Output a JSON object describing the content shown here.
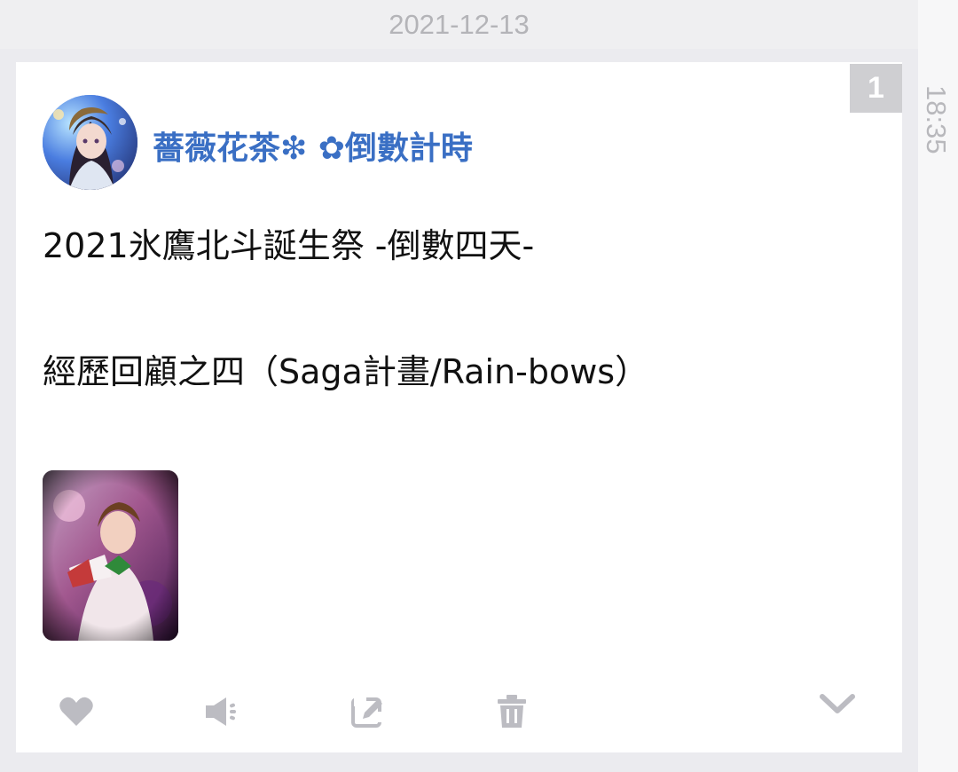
{
  "header": {
    "date": "2021-12-13"
  },
  "side": {
    "time": "18:35"
  },
  "post": {
    "badge": "1",
    "author": "薔薇花茶❇ ✿倒數計時",
    "lines": [
      "2021氷鷹北斗誕生祭 -倒數四天-",
      "經歷回顧之四（Saga計畫/Rain-bows）"
    ]
  },
  "actions": [
    {
      "name": "like",
      "icon": "heart-icon"
    },
    {
      "name": "announce",
      "icon": "megaphone-icon"
    },
    {
      "name": "edit",
      "icon": "edit-icon"
    },
    {
      "name": "delete",
      "icon": "trash-icon"
    },
    {
      "name": "more",
      "icon": "chevron-down-icon"
    }
  ],
  "colors": {
    "author": "#3a6fc4",
    "icon": "#bcbcc2",
    "badge": "#cfcfd2"
  }
}
